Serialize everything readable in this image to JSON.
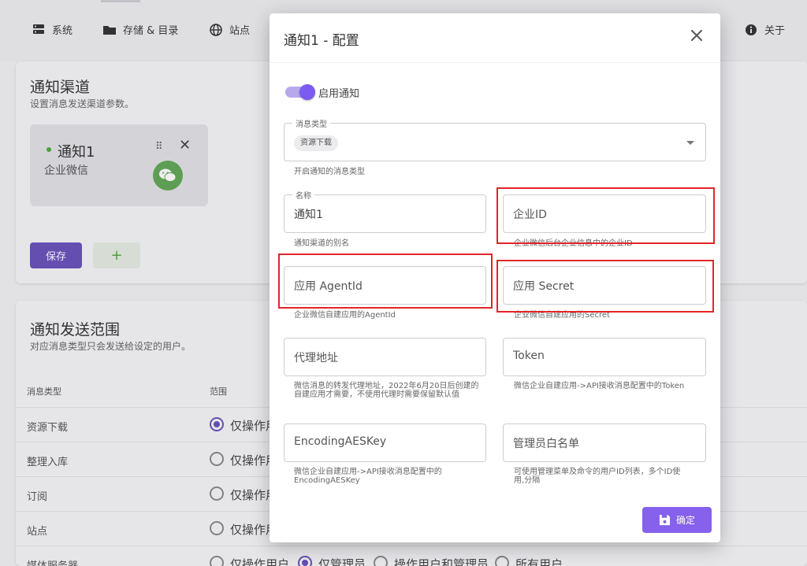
{
  "nav": {
    "system": "系统",
    "storage": "存储 & 目录",
    "sites": "站点",
    "about": "关于"
  },
  "channels": {
    "title": "通知渠道",
    "subtitle": "设置消息发送渠道参数。",
    "card": {
      "name": "通知1",
      "type": "企业微信"
    },
    "save_label": "保存",
    "add_label": "+"
  },
  "scope": {
    "title": "通知发送范围",
    "subtitle": "对应消息类型只会发送给设定的用户。",
    "col_type": "消息类型",
    "col_scope": "范围",
    "rows": [
      {
        "type": "资源下载",
        "option": "仅操作用"
      },
      {
        "type": "整理入库",
        "option": "仅操作用"
      },
      {
        "type": "订阅",
        "option": "仅操作用"
      },
      {
        "type": "站点",
        "option": "仅操作用"
      },
      {
        "type": "媒体服务器"
      }
    ],
    "full_options": [
      "仅操作用户",
      "仅管理员",
      "操作用户和管理员",
      "所有用户"
    ]
  },
  "modal": {
    "title": "通知1 - 配置",
    "enable_label": "启用通知",
    "msg_type": {
      "label": "消息类型",
      "chip": "资源下载",
      "hint": "开启通知的消息类型"
    },
    "name": {
      "label": "名称",
      "value": "通知1",
      "hint": "通知渠道的别名"
    },
    "corp_id": {
      "placeholder": "企业ID",
      "hint": "企业微信后台企业信息中的企业ID"
    },
    "agent_id": {
      "placeholder": "应用 AgentId",
      "hint": "企业微信自建应用的AgentId"
    },
    "secret": {
      "placeholder": "应用 Secret",
      "hint": "企业微信自建应用的Secret"
    },
    "proxy": {
      "placeholder": "代理地址",
      "hint": "微信消息的转发代理地址，2022年6月20日后创建的自建应用才需要，不使用代理时需要保留默认值"
    },
    "token": {
      "placeholder": "Token",
      "hint": "微信企业自建应用->API接收消息配置中的Token"
    },
    "aes": {
      "placeholder": "EncodingAESKey",
      "hint": "微信企业自建应用->API接收消息配置中的EncodingAESKey"
    },
    "admins": {
      "placeholder": "管理员白名单",
      "hint": "可使用管理菜单及命令的用户ID列表，多个ID使用,分隔"
    },
    "confirm_label": "确定"
  },
  "colors": {
    "primary": "#8561ec",
    "save": "#6a52bb",
    "highlight": "#e4242a",
    "wechat": "#63a957"
  }
}
